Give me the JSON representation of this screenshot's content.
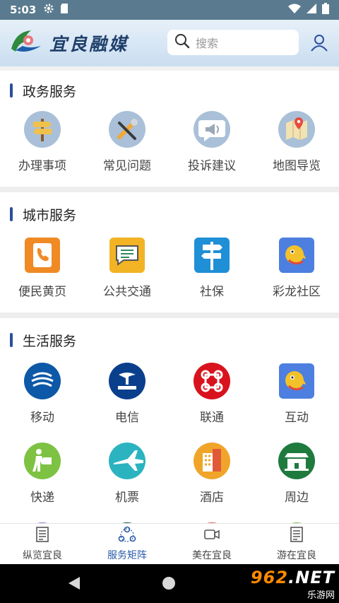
{
  "status_bar": {
    "time": "5:03"
  },
  "header": {
    "logo_text": "宜良融媒",
    "search_placeholder": "搜索"
  },
  "sections": [
    {
      "title": "政务服务",
      "items": [
        {
          "label": "办理事项",
          "icon": "signpost-icon"
        },
        {
          "label": "常见问题",
          "icon": "tools-icon"
        },
        {
          "label": "投诉建议",
          "icon": "megaphone-icon"
        },
        {
          "label": "地图导览",
          "icon": "map-icon"
        }
      ]
    },
    {
      "title": "城市服务",
      "items": [
        {
          "label": "便民黄页",
          "icon": "phonebook-icon"
        },
        {
          "label": "公共交通",
          "icon": "message-icon"
        },
        {
          "label": "社保",
          "icon": "direction-sign-icon"
        },
        {
          "label": "彩龙社区",
          "icon": "dragon-icon"
        }
      ]
    },
    {
      "title": "生活服务",
      "items": [
        {
          "label": "移动",
          "icon": "china-mobile-icon"
        },
        {
          "label": "电信",
          "icon": "china-telecom-icon"
        },
        {
          "label": "联通",
          "icon": "china-unicom-icon"
        },
        {
          "label": "互动",
          "icon": "dragon-icon"
        },
        {
          "label": "快递",
          "icon": "courier-icon"
        },
        {
          "label": "机票",
          "icon": "airplane-icon"
        },
        {
          "label": "酒店",
          "icon": "hotel-icon"
        },
        {
          "label": "周边",
          "icon": "landmark-icon"
        }
      ]
    }
  ],
  "bottom_nav": [
    {
      "label": "纵览宜良",
      "icon": "news-icon",
      "active": false
    },
    {
      "label": "服务矩阵",
      "icon": "network-icon",
      "active": true
    },
    {
      "label": "美在宜良",
      "icon": "video-icon",
      "active": false
    },
    {
      "label": "游在宜良",
      "icon": "news-icon",
      "active": false
    }
  ],
  "watermark": {
    "main": "962",
    "suffix": ".NET",
    "sub": "乐游网"
  },
  "colors": {
    "accent": "#2a4f9b",
    "active_nav": "#2a5aa8",
    "status_bar": "#5a7b8f"
  }
}
